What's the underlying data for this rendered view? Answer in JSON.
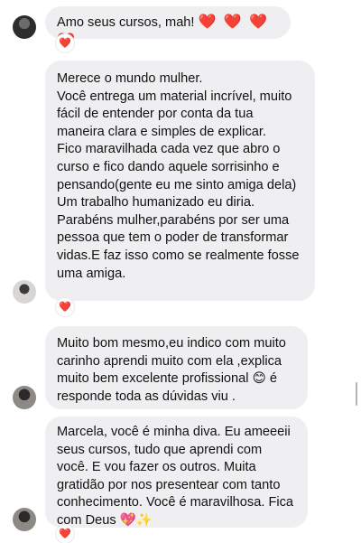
{
  "messages": [
    {
      "text": "Amo seus cursos, mah!",
      "emoji": "❤️ ❤️ ❤️ ❤️",
      "reaction": "❤️"
    },
    {
      "text": "Merece o mundo mulher.\nVocê entrega um material incrível, muito fácil de entender por conta da tua maneira clara e simples de explicar.\nFico maravilhada cada vez que abro o curso e fico dando aquele sorrisinho e pensando(gente eu me sinto amiga dela)\nUm trabalho humanizado eu diria.\nParabéns mulher,parabéns por ser uma pessoa que tem o poder de transformar vidas.E faz isso como se realmente fosse uma amiga.",
      "reaction": "❤️"
    },
    {
      "text": "Muito bom mesmo,eu indico com muito carinho aprendi muito com ela ,explica muito bem excelente profissional 😊 é responde toda as dúvidas viu ."
    },
    {
      "text": "Marcela, você é minha diva. Eu ameeeii seus cursos, tudo que aprendi com você. E vou fazer os outros. Muita gratidão por nos presentear com tanto conhecimento. Você é maravilhosa. Fica com Deus 💖✨",
      "reaction": "❤️"
    }
  ]
}
